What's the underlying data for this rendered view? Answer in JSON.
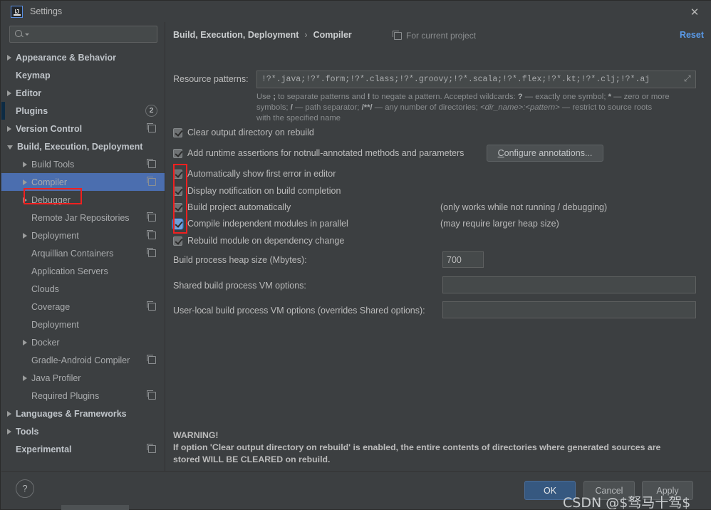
{
  "window": {
    "title": "Settings",
    "logo_text": "IJ",
    "close_icon": "close-icon"
  },
  "sidebar": {
    "search": {
      "value": "",
      "placeholder": ""
    },
    "items": [
      {
        "label": "Appearance & Behavior",
        "level": 0,
        "arrow": "right",
        "bold": true,
        "copy": false
      },
      {
        "label": "Keymap",
        "level": 0,
        "arrow": "none",
        "bold": true,
        "copy": false
      },
      {
        "label": "Editor",
        "level": 0,
        "arrow": "right",
        "bold": true,
        "copy": false
      },
      {
        "label": "Plugins",
        "level": 0,
        "arrow": "none",
        "bold": true,
        "copy": false,
        "badge": "2",
        "leftmark": true
      },
      {
        "label": "Version Control",
        "level": 0,
        "arrow": "right",
        "bold": true,
        "copy": true
      },
      {
        "label": "Build, Execution, Deployment",
        "level": 0,
        "arrow": "down",
        "bold": true,
        "copy": false
      },
      {
        "label": "Build Tools",
        "level": 1,
        "arrow": "right",
        "bold": false,
        "copy": true
      },
      {
        "label": "Compiler",
        "level": 1,
        "arrow": "right",
        "bold": false,
        "copy": true,
        "selected": true,
        "annotated": true
      },
      {
        "label": "Debugger",
        "level": 1,
        "arrow": "right",
        "bold": false,
        "copy": false
      },
      {
        "label": "Remote Jar Repositories",
        "level": 1,
        "arrow": "none",
        "bold": false,
        "copy": true
      },
      {
        "label": "Deployment",
        "level": 1,
        "arrow": "right",
        "bold": false,
        "copy": true
      },
      {
        "label": "Arquillian Containers",
        "level": 1,
        "arrow": "none",
        "bold": false,
        "copy": true
      },
      {
        "label": "Application Servers",
        "level": 1,
        "arrow": "none",
        "bold": false,
        "copy": false
      },
      {
        "label": "Clouds",
        "level": 1,
        "arrow": "none",
        "bold": false,
        "copy": false
      },
      {
        "label": "Coverage",
        "level": 1,
        "arrow": "none",
        "bold": false,
        "copy": true
      },
      {
        "label": "Deployment",
        "level": 1,
        "arrow": "none",
        "bold": false,
        "copy": false
      },
      {
        "label": "Docker",
        "level": 1,
        "arrow": "right",
        "bold": false,
        "copy": false
      },
      {
        "label": "Gradle-Android Compiler",
        "level": 1,
        "arrow": "none",
        "bold": false,
        "copy": true
      },
      {
        "label": "Java Profiler",
        "level": 1,
        "arrow": "right",
        "bold": false,
        "copy": false
      },
      {
        "label": "Required Plugins",
        "level": 1,
        "arrow": "none",
        "bold": false,
        "copy": true
      },
      {
        "label": "Languages & Frameworks",
        "level": 0,
        "arrow": "right",
        "bold": true,
        "copy": false
      },
      {
        "label": "Tools",
        "level": 0,
        "arrow": "right",
        "bold": true,
        "copy": false
      },
      {
        "label": "Experimental",
        "level": 0,
        "arrow": "none",
        "bold": true,
        "copy": true
      }
    ]
  },
  "main": {
    "breadcrumb": {
      "parent": "Build, Execution, Deployment",
      "separator": "›",
      "current": "Compiler"
    },
    "scope_label": "For current project",
    "reset_label": "Reset",
    "resource_patterns": {
      "label": "Resource patterns:",
      "value": "!?*.java;!?*.form;!?*.class;!?*.groovy;!?*.scala;!?*.flex;!?*.kt;!?*.clj;!?*.aj",
      "expand_icon": "expand-icon"
    },
    "help_text": {
      "line1_a": "Use ",
      "line1_semicolon": ";",
      "line1_b": " to separate patterns and ",
      "line1_bang": "!",
      "line1_c": " to negate a pattern. Accepted wildcards: ",
      "line1_q": "?",
      "line1_d": " — exactly one symbol; ",
      "line1_star": "*",
      "line1_e": " — zero or more",
      "line2_a": "symbols; ",
      "line2_slash": "/",
      "line2_b": " — path separator; ",
      "line2_dblstar": "/**/",
      "line2_c": " — any number of directories;  ",
      "line2_dir": "<dir_name>:<pattern>",
      "line2_d": " — restrict to source roots",
      "line3": "with the specified name"
    },
    "checkboxes": [
      {
        "label": "Clear output directory on rebuild",
        "checked": true,
        "focused": false,
        "note": ""
      },
      {
        "label": "Add runtime assertions for notnull-annotated methods and parameters",
        "checked": true,
        "focused": false,
        "note": ""
      },
      {
        "label": "Automatically show first error in editor",
        "checked": true,
        "focused": false,
        "note": ""
      },
      {
        "label": "Display notification on build completion",
        "checked": true,
        "focused": false,
        "note": ""
      },
      {
        "label": "Build project automatically",
        "checked": true,
        "focused": false,
        "note": "(only works while not running / debugging)"
      },
      {
        "label": "Compile independent modules in parallel",
        "checked": true,
        "focused": true,
        "note": "(may require larger heap size)"
      },
      {
        "label": "Rebuild module on dependency change",
        "checked": true,
        "focused": false,
        "note": ""
      }
    ],
    "configure_annotations_label": "Configure annotations...",
    "fields": [
      {
        "label": "Build process heap size (Mbytes):",
        "value": "700"
      },
      {
        "label": "Shared build process VM options:",
        "value": ""
      },
      {
        "label": "User-local build process VM options (overrides Shared options):",
        "value": ""
      }
    ],
    "warning": {
      "heading": "WARNING!",
      "line1": "If option 'Clear output directory on rebuild' is enabled, the entire contents of directories where generated sources are",
      "line2": "stored WILL BE CLEARED on rebuild."
    }
  },
  "footer": {
    "help_label": "?",
    "ok_label": "OK",
    "cancel_label": "Cancel",
    "apply_label": "Apply"
  },
  "watermark": {
    "text": "CSDN @$驽马十驾$"
  },
  "colors": {
    "background": "#3c3f41",
    "selection": "#4b6eaf",
    "accent_link": "#5a9ae8",
    "ok_button": "#365880",
    "annotation": "#f02020",
    "field_bg": "#45494a"
  }
}
